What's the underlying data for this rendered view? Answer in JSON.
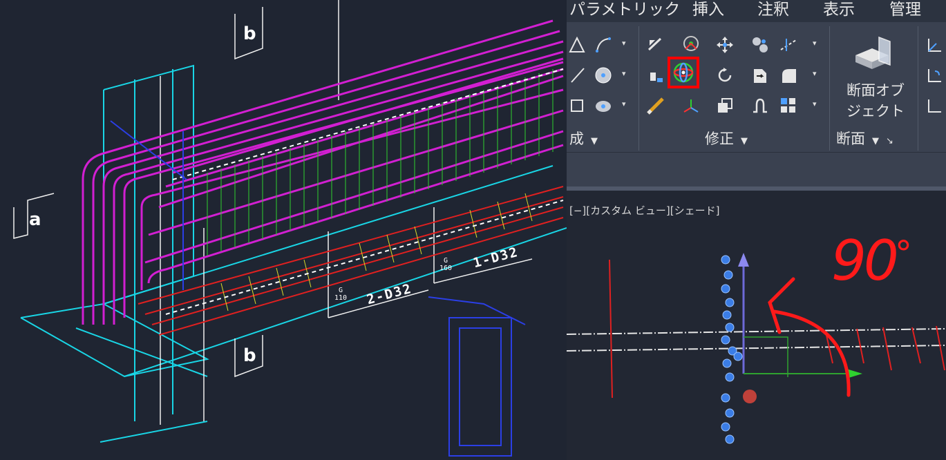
{
  "left_view": {
    "section_labels": [
      "b",
      "a",
      "b"
    ],
    "bar_callouts": [
      {
        "badge_top": "G",
        "badge_bottom": "110",
        "text": "2-D32"
      },
      {
        "badge_top": "G",
        "badge_bottom": "160",
        "text": "1-D32"
      }
    ]
  },
  "menu": {
    "items": [
      "パラメトリック",
      "挿入",
      "注釈",
      "表示",
      "管理"
    ]
  },
  "ribbon": {
    "panels": [
      {
        "label": "成"
      },
      {
        "label": "修正"
      },
      {
        "label": "断面"
      }
    ],
    "large_button": {
      "line1": "断面オブ",
      "line2": "ジェクト"
    },
    "highlight_color": "#ff0000",
    "highlighted_tool": "3d-rotate-icon"
  },
  "viewport": {
    "label": "[−][カスタム ビュー][シェード]",
    "annotation": {
      "text": "90",
      "degree": "°",
      "color": "#ff1a1a"
    }
  }
}
